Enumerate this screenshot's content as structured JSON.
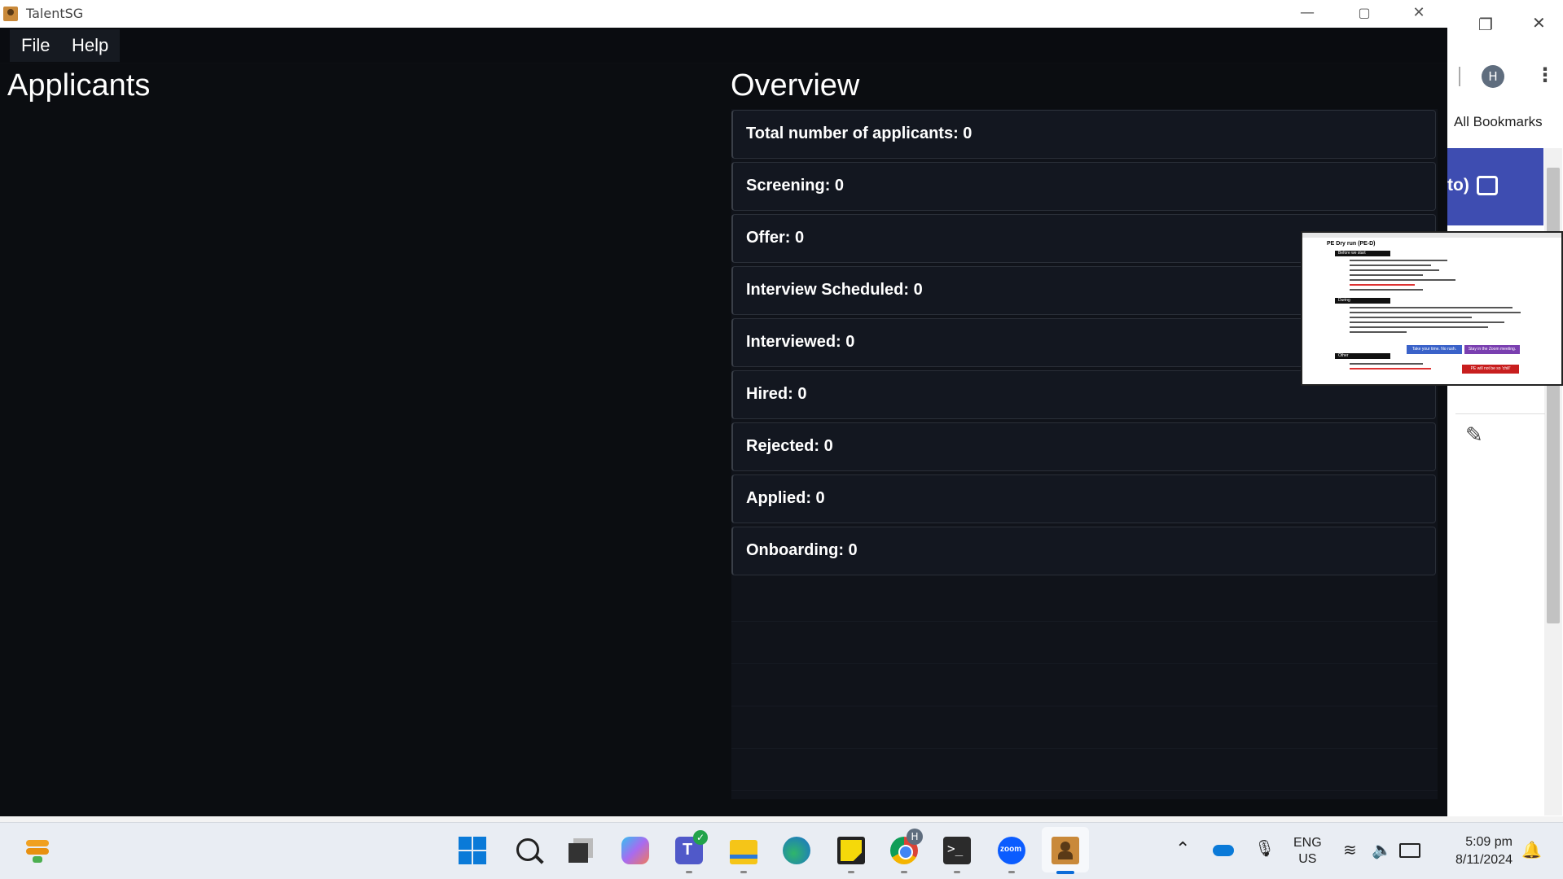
{
  "window": {
    "title": "TalentSG",
    "controls": {
      "minimize": "—",
      "maximize": "▢",
      "close": "✕"
    }
  },
  "menu": {
    "items": [
      {
        "label": "File"
      },
      {
        "label": "Help"
      }
    ]
  },
  "applicants": {
    "title": "Applicants"
  },
  "overview": {
    "title": "Overview",
    "items": [
      {
        "label": "Total number of applicants: 0"
      },
      {
        "label": "Screening: 0"
      },
      {
        "label": "Offer: 0"
      },
      {
        "label": "Interview Scheduled: 0"
      },
      {
        "label": "Interviewed: 0"
      },
      {
        "label": "Hired: 0"
      },
      {
        "label": "Rejected: 0"
      },
      {
        "label": "Applied: 0"
      },
      {
        "label": "Onboarding: 0"
      }
    ]
  },
  "browser": {
    "avatar": "H",
    "bookmarks_label": "All Bookmarks",
    "banner_text": "to)",
    "doc_preview": {
      "title": "PE Dry run (PE-D)",
      "sections": [
        "Before we start",
        "During",
        "Other"
      ],
      "buttons": [
        "Take your time. No rush.",
        "Stay in the Zoom meeting.",
        "PE will not be so 'chill'"
      ]
    }
  },
  "taskbar": {
    "apps": [
      "start-icon",
      "search-icon",
      "task-view-icon",
      "copilot-icon",
      "teams-icon",
      "file-explorer-icon",
      "edge-icon",
      "sticky-notes-icon",
      "chrome-icon",
      "terminal-icon",
      "zoom-icon",
      "talentsg-icon"
    ],
    "zoom_label": "zoom",
    "language": {
      "line1": "ENG",
      "line2": "US"
    },
    "time": "5:09 pm",
    "date": "8/11/2024",
    "colors": {
      "accent": "#3e4db1",
      "app_bg": "#0b0d11"
    }
  }
}
